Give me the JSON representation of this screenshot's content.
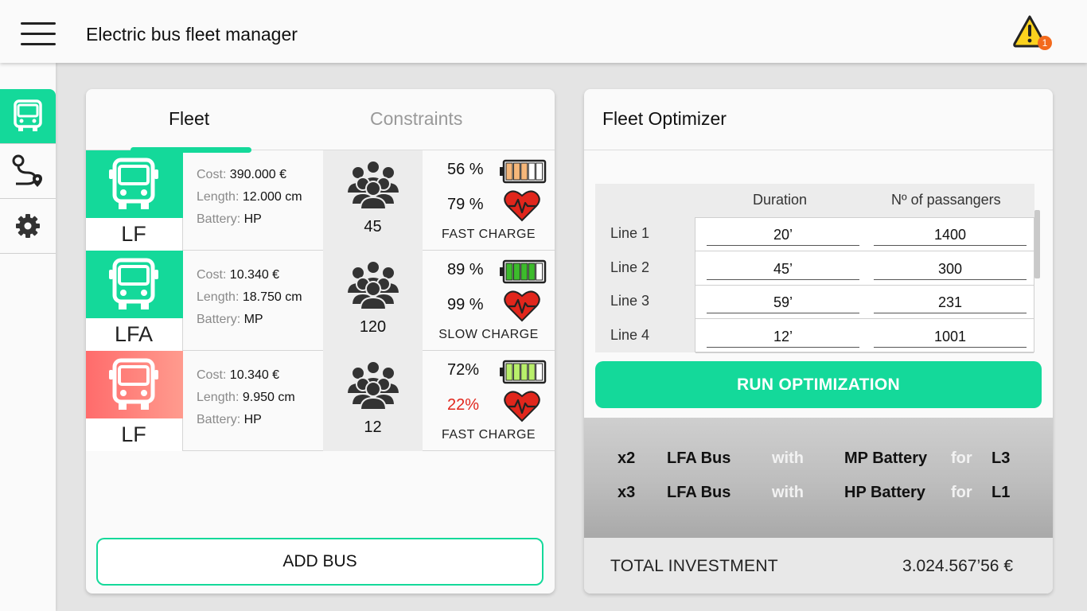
{
  "header": {
    "title": "Electric bus fleet manager",
    "alert_count": "1"
  },
  "sidebar": {
    "items": [
      {
        "name": "bus-icon",
        "active": true
      },
      {
        "name": "route-icon",
        "active": false
      },
      {
        "name": "gear-icon",
        "active": false
      }
    ]
  },
  "fleet": {
    "tabs": [
      "Fleet",
      "Constraints"
    ],
    "active_tab": "Fleet",
    "labels": {
      "cost": "Cost:",
      "length": "Length:",
      "battery": "Battery:"
    },
    "buses": [
      {
        "type": "LF",
        "status_color": "#14d99a",
        "cost": "390.000 €",
        "length": "12.000 cm",
        "battery": "HP",
        "passengers": "45",
        "charge_pct": "56 %",
        "charge_level": 0.56,
        "battery_color": "#f5b77a",
        "health_pct": "79 %",
        "health_low": false,
        "charge_type": "FAST CHARGE"
      },
      {
        "type": "LFA",
        "status_color": "#14d99a",
        "cost": "10.340 €",
        "length": "18.750 cm",
        "battery": "MP",
        "passengers": "120",
        "charge_pct": "89 %",
        "charge_level": 0.89,
        "battery_color": "#3dbb2c",
        "health_pct": "99 %",
        "health_low": false,
        "charge_type": "SLOW CHARGE"
      },
      {
        "type": "LF",
        "status_color": "#ff6b6b",
        "cost": "10.340 €",
        "length": "9.950 cm",
        "battery": "HP",
        "passengers": "12",
        "charge_pct": "72%",
        "charge_level": 0.72,
        "battery_color": "#b9ef6b",
        "health_pct": "22%",
        "health_low": true,
        "charge_type": "FAST CHARGE"
      }
    ],
    "add_bus_label": "ADD BUS"
  },
  "optimizer": {
    "title": "Fleet Optimizer",
    "columns": [
      "Duration",
      "Nº of passangers"
    ],
    "lines": [
      {
        "name": "Line 1",
        "duration": "20’",
        "passengers": "1400"
      },
      {
        "name": "Line 2",
        "duration": "45’",
        "passengers": "300"
      },
      {
        "name": "Line 3",
        "duration": "59’",
        "passengers": "231"
      },
      {
        "name": "Line 4",
        "duration": "12’",
        "passengers": "1001"
      }
    ],
    "run_label": "RUN OPTIMIZATION",
    "results": [
      {
        "qty": "x2",
        "bus": "LFA Bus",
        "with": "with",
        "battery": "MP Battery",
        "for": "for",
        "line": "L3"
      },
      {
        "qty": "x3",
        "bus": "LFA Bus",
        "with": "with",
        "battery": "HP Battery",
        "for": "for",
        "line": "L1"
      }
    ],
    "total_label": "TOTAL INVESTMENT",
    "total_value": "3.024.567’56 €"
  },
  "colors": {
    "accent": "#14d99a",
    "alert": "#f36a1c",
    "danger": "#e1261c",
    "heart": "#e1261c"
  }
}
